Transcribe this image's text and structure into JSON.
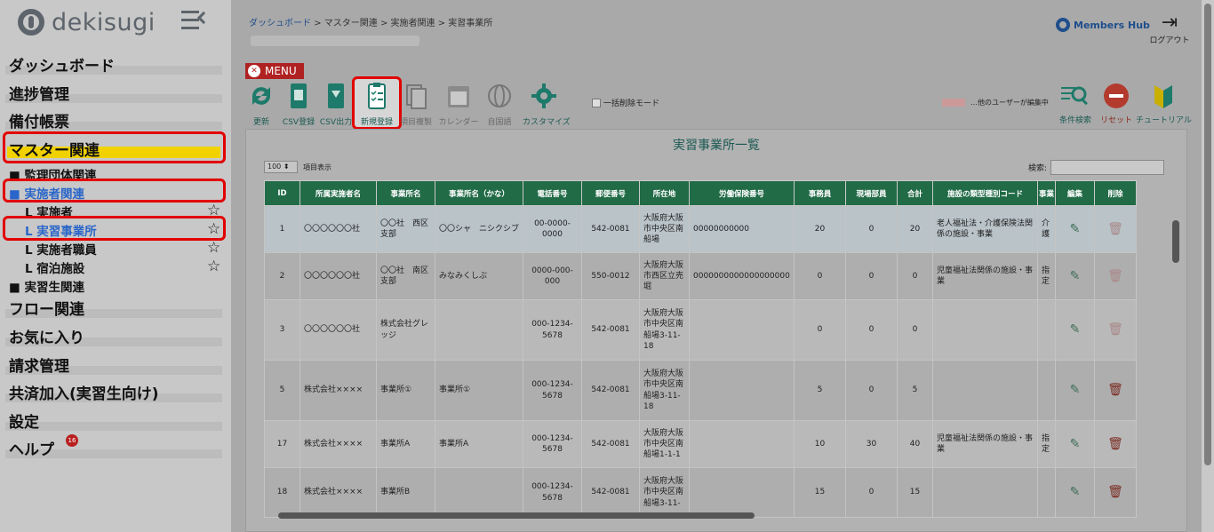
{
  "brand": {
    "name": "dekisugi"
  },
  "sidebar": {
    "items": [
      {
        "label": "ダッシュボード"
      },
      {
        "label": "進捗管理"
      },
      {
        "label": "備付帳票"
      },
      {
        "label": "マスター関連"
      },
      {
        "label": "フロー関連"
      },
      {
        "label": "お気に入り"
      },
      {
        "label": "請求管理"
      },
      {
        "label": "共済加入(実習生向け)"
      },
      {
        "label": "設定"
      },
      {
        "label": "ヘルプ"
      }
    ],
    "sub": {
      "supervising": "■ 監理団体関連",
      "implementer": "■ 実施者関連",
      "implementer_items": [
        "L 実施者",
        "L 実習事業所",
        "L 実施者職員",
        "L 宿泊施設"
      ],
      "trainee": "■ 実習生関連"
    },
    "help_badge": "16"
  },
  "header": {
    "breadcrumb": [
      "ダッシュボード",
      "マスター関連",
      "実施者関連",
      "実習事業所"
    ],
    "breadcrumb_sep": ">",
    "members_hub": "Members Hub",
    "logout": "ログアウト"
  },
  "toolbar": {
    "menu": "MENU",
    "tools": [
      "更新",
      "CSV登録",
      "CSV出力",
      "新規登録",
      "項目複製",
      "カレンダー",
      "自国語",
      "カスタマイズ"
    ],
    "bulk_delete": "一括削除モード",
    "editing_legend": "…他のユーザーが編集中",
    "condition_search": "条件検索",
    "reset": "リセット",
    "tutorial": "チュートリアル"
  },
  "panel": {
    "title": "実習事業所一覧",
    "page_size": "100",
    "page_size_suffix": "項目表示",
    "search_label": "検索:"
  },
  "table": {
    "columns": [
      "ID",
      "所属実施者名",
      "事業所名",
      "事業所名（かな）",
      "電話番号",
      "郵便番号",
      "所在地",
      "労働保険番号",
      "事務員",
      "現場部員",
      "合計",
      "施設の類型種別コード",
      "事業",
      "編集",
      "削除"
    ],
    "rows": [
      {
        "id": "1",
        "company": "〇〇〇〇〇〇社",
        "office": "〇〇社　西区支部",
        "kana": "〇〇シャ　ニシクシブ",
        "phone": "00-0000-0000",
        "zip": "542-0081",
        "address": "大阪府大阪市中央区南船場",
        "insurance": "00000000000",
        "clerks": "20",
        "field": "0",
        "total": "20",
        "facility": "老人福祉法・介護保険法関係の施設・事業",
        "biz": "介護"
      },
      {
        "id": "2",
        "company": "〇〇〇〇〇〇社",
        "office": "〇〇社　南区支部",
        "kana": "みなみくしぶ",
        "phone": "0000-000-000",
        "zip": "550-0012",
        "address": "大阪府大阪市西区立売堀",
        "insurance": "0000000000000000000",
        "clerks": "0",
        "field": "0",
        "total": "0",
        "facility": "児童福祉法関係の施設・事業",
        "biz": "指定"
      },
      {
        "id": "3",
        "company": "〇〇〇〇〇〇社",
        "office": "株式会社グレッジ",
        "kana": "",
        "phone": "000-1234-5678",
        "zip": "542-0081",
        "address": "大阪府大阪市中央区南船場3-11-18",
        "insurance": "",
        "clerks": "0",
        "field": "0",
        "total": "0",
        "facility": "",
        "biz": ""
      },
      {
        "id": "5",
        "company": "株式会社××××",
        "office": "事業所①",
        "kana": "事業所①",
        "phone": "000-1234-5678",
        "zip": "542-0081",
        "address": "大阪府大阪市中央区南船場3-11-18",
        "insurance": "",
        "clerks": "5",
        "field": "0",
        "total": "5",
        "facility": "",
        "biz": ""
      },
      {
        "id": "17",
        "company": "株式会社××××",
        "office": "事業所A",
        "kana": "事業所A",
        "phone": "000-1234-5678",
        "zip": "542-0081",
        "address": "大阪府大阪市中央区南船場1-1-1",
        "insurance": "",
        "clerks": "10",
        "field": "30",
        "total": "40",
        "facility": "児童福祉法関係の施設・事業",
        "biz": "指定"
      },
      {
        "id": "18",
        "company": "株式会社××××",
        "office": "事業所B",
        "kana": "",
        "phone": "000-1234-5678",
        "zip": "542-0081",
        "address": "大阪府大阪市中央区南船場3-11-",
        "insurance": "",
        "clerks": "15",
        "field": "0",
        "total": "15",
        "facility": "",
        "biz": ""
      }
    ]
  },
  "colors": {
    "header_green": "#216b47",
    "highlight_red": "#e20000",
    "accent_yellow": "#f1d200",
    "link_blue": "#1f4e8c"
  }
}
